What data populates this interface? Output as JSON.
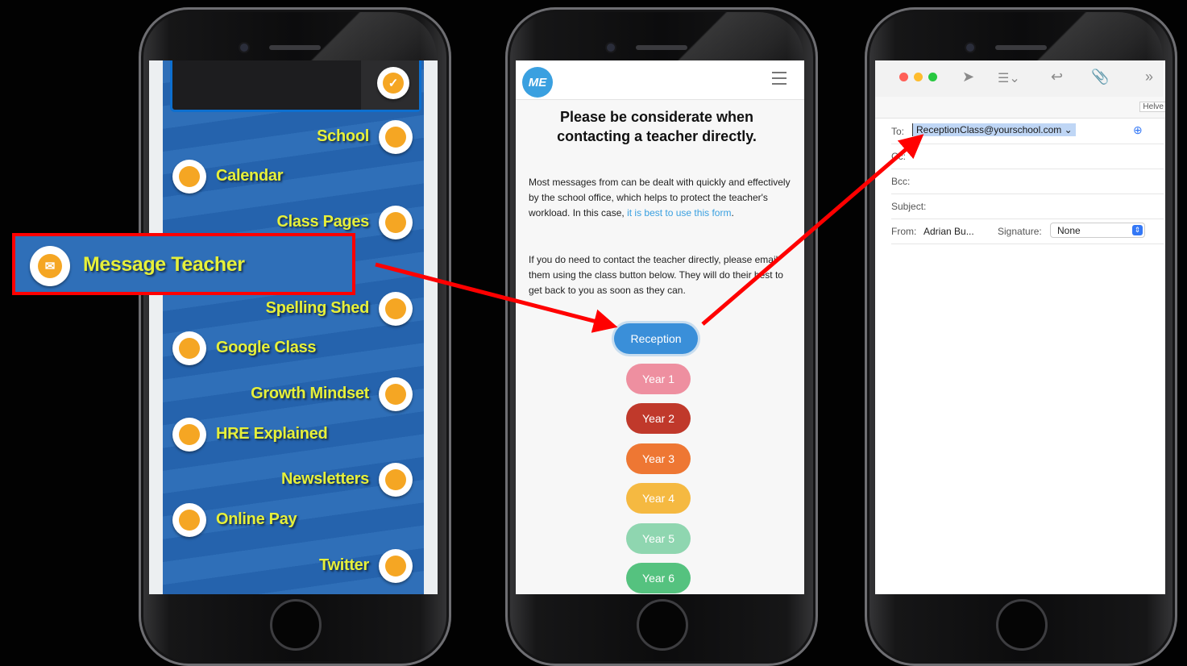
{
  "menu": {
    "items": [
      {
        "label": "School",
        "icon": "www-icon",
        "side": "right"
      },
      {
        "label": "Calendar",
        "icon": "calendar-icon",
        "side": "left"
      },
      {
        "label": "Class Pages",
        "icon": "class-pages-icon",
        "side": "right"
      },
      {
        "label": "Message Teacher",
        "icon": "envelope-icon",
        "side": "left"
      },
      {
        "label": "Spelling Shed",
        "icon": "spelling-shed-icon",
        "side": "right"
      },
      {
        "label": "Google Class",
        "icon": "google-class-icon",
        "side": "left"
      },
      {
        "label": "Growth Mindset",
        "icon": "lightbulb-icon",
        "side": "right"
      },
      {
        "label": "HRE Explained",
        "icon": "heart-icon",
        "side": "left"
      },
      {
        "label": "Newsletters",
        "icon": "newsletter-icon",
        "side": "right"
      },
      {
        "label": "Online Pay",
        "icon": "payment-icon",
        "side": "left"
      },
      {
        "label": "Twitter",
        "icon": "twitter-icon",
        "side": "right"
      }
    ],
    "highlighted": "Message Teacher"
  },
  "webpage": {
    "heading": "Please be considerate when contacting a teacher directly.",
    "para1": "Most messages from can be dealt with quickly and effectively by the school office, which helps to protect the teacher's workload. In this case, ",
    "para1_link": "it is best to use this form",
    "para1_end": ".",
    "para2": "If you do need to contact the teacher directly, please email them using the class button below. They will do their best to get back to you as soon as they can.",
    "buttons": [
      {
        "label": "Reception",
        "color": "#3a8fd9"
      },
      {
        "label": "Year 1",
        "color": "#ee8fa0"
      },
      {
        "label": "Year 2",
        "color": "#c0392b"
      },
      {
        "label": "Year 3",
        "color": "#ee7733"
      },
      {
        "label": "Year 4",
        "color": "#f5b941"
      },
      {
        "label": "Year 5",
        "color": "#8fd6b0"
      },
      {
        "label": "Year 6",
        "color": "#55c27f"
      }
    ]
  },
  "mail": {
    "font_hint": "Helve",
    "to_label": "To:",
    "to_value": "ReceptionClass@yourschool.com",
    "cc_label": "Cc:",
    "bcc_label": "Bcc:",
    "subject_label": "Subject:",
    "from_label": "From:",
    "from_value": "Adrian Bu...",
    "signature_label": "Signature:",
    "signature_value": "None"
  },
  "colors": {
    "highlight": "#ff0000",
    "menu_blue": "#2f6fb8",
    "label_yellow": "#e6f03a",
    "icon_orange": "#f5a623"
  }
}
